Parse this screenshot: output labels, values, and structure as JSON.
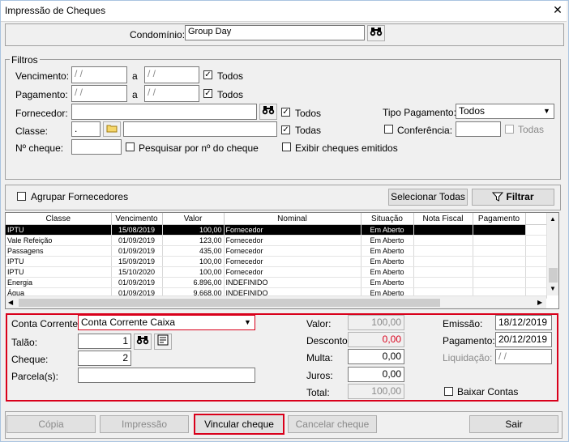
{
  "window": {
    "title": "Impressão de Cheques",
    "close": "✕"
  },
  "condominio": {
    "label": "Condomínio:",
    "value": "Group Day"
  },
  "filtros": {
    "legend": "Filtros",
    "vencimento_label": "Vencimento:",
    "vencimento_de": "/ /",
    "vencimento_a": "/ /",
    "a_label": "a",
    "vencimento_todos": "Todos",
    "pagamento_label": "Pagamento:",
    "pagamento_de": "/ /",
    "pagamento_a": "/ /",
    "pagamento_todos": "Todos",
    "fornecedor_label": "Fornecedor:",
    "fornecedor_value": "",
    "fornecedor_todos": "Todos",
    "tipo_pagamento_label": "Tipo Pagamento:",
    "tipo_pagamento_value": "Todos",
    "classe_label": "Classe:",
    "classe_code": ".",
    "classe_value": "",
    "classe_todas": "Todas",
    "conferencia_label": "Conferência:",
    "conferencia_value": "",
    "conferencia_todas": "Todas",
    "cheque_label": "Nº cheque:",
    "cheque_value": "",
    "pesquisar_label": "Pesquisar por nº do cheque",
    "exibir_label": "Exibir cheques emitidos"
  },
  "actions": {
    "agrupar_label": "Agrupar Fornecedores",
    "selecionar_todas": "Selecionar Todas",
    "filtrar": "Filtrar"
  },
  "grid": {
    "columns": [
      "Classe",
      "Vencimento",
      "Valor",
      "Nominal",
      "Situação",
      "Nota Fiscal",
      "Pagamento"
    ],
    "rows": [
      {
        "classe": "IPTU",
        "vencimento": "15/08/2019",
        "valor": "100,00",
        "nominal": "Fornecedor",
        "situacao": "Em Aberto",
        "nota": "",
        "pagamento": ""
      },
      {
        "classe": "Vale Refeição",
        "vencimento": "01/09/2019",
        "valor": "123,00",
        "nominal": "Fornecedor",
        "situacao": "Em Aberto",
        "nota": "",
        "pagamento": ""
      },
      {
        "classe": "Passagens",
        "vencimento": "01/09/2019",
        "valor": "435,00",
        "nominal": "Fornecedor",
        "situacao": "Em Aberto",
        "nota": "",
        "pagamento": ""
      },
      {
        "classe": "IPTU",
        "vencimento": "15/09/2019",
        "valor": "100,00",
        "nominal": "Fornecedor",
        "situacao": "Em Aberto",
        "nota": "",
        "pagamento": ""
      },
      {
        "classe": "IPTU",
        "vencimento": "15/10/2020",
        "valor": "100,00",
        "nominal": "Fornecedor",
        "situacao": "Em Aberto",
        "nota": "",
        "pagamento": ""
      },
      {
        "classe": "Energia",
        "vencimento": "01/09/2019",
        "valor": "6.896,00",
        "nominal": "INDEFINIDO",
        "situacao": "Em Aberto",
        "nota": "",
        "pagamento": ""
      },
      {
        "classe": "Água",
        "vencimento": "01/09/2019",
        "valor": "9.668,00",
        "nominal": "INDEFINIDO",
        "situacao": "Em Aberto",
        "nota": "",
        "pagamento": ""
      }
    ]
  },
  "cheque_form": {
    "conta_label": "Conta Corrente:",
    "conta_value": "Conta Corrente Caixa",
    "talao_label": "Talão:",
    "talao_value": "1",
    "cheque_label": "Cheque:",
    "cheque_value": "2",
    "parcela_label": "Parcela(s):",
    "parcela_value": "",
    "valor_label": "Valor:",
    "valor_value": "100,00",
    "desconto_label": "Desconto:",
    "desconto_value": "0,00",
    "multa_label": "Multa:",
    "multa_value": "0,00",
    "juros_label": "Juros:",
    "juros_value": "0,00",
    "total_label": "Total:",
    "total_value": "100,00",
    "emissao_label": "Emissão:",
    "emissao_value": "18/12/2019",
    "pagamento_label": "Pagamento:",
    "pagamento_value": "20/12/2019",
    "liquidacao_label": "Liquidação:",
    "liquidacao_value": "/ /",
    "baixar_label": "Baixar Contas"
  },
  "footer": {
    "copia": "Cópia",
    "impressao": "Impressão",
    "vincular": "Vincular cheque",
    "cancelar": "Cancelar cheque",
    "sair": "Sair"
  },
  "colors": {
    "highlight": "#d9001b",
    "selected_row": "#000000",
    "desconto_text": "#d9001b"
  }
}
